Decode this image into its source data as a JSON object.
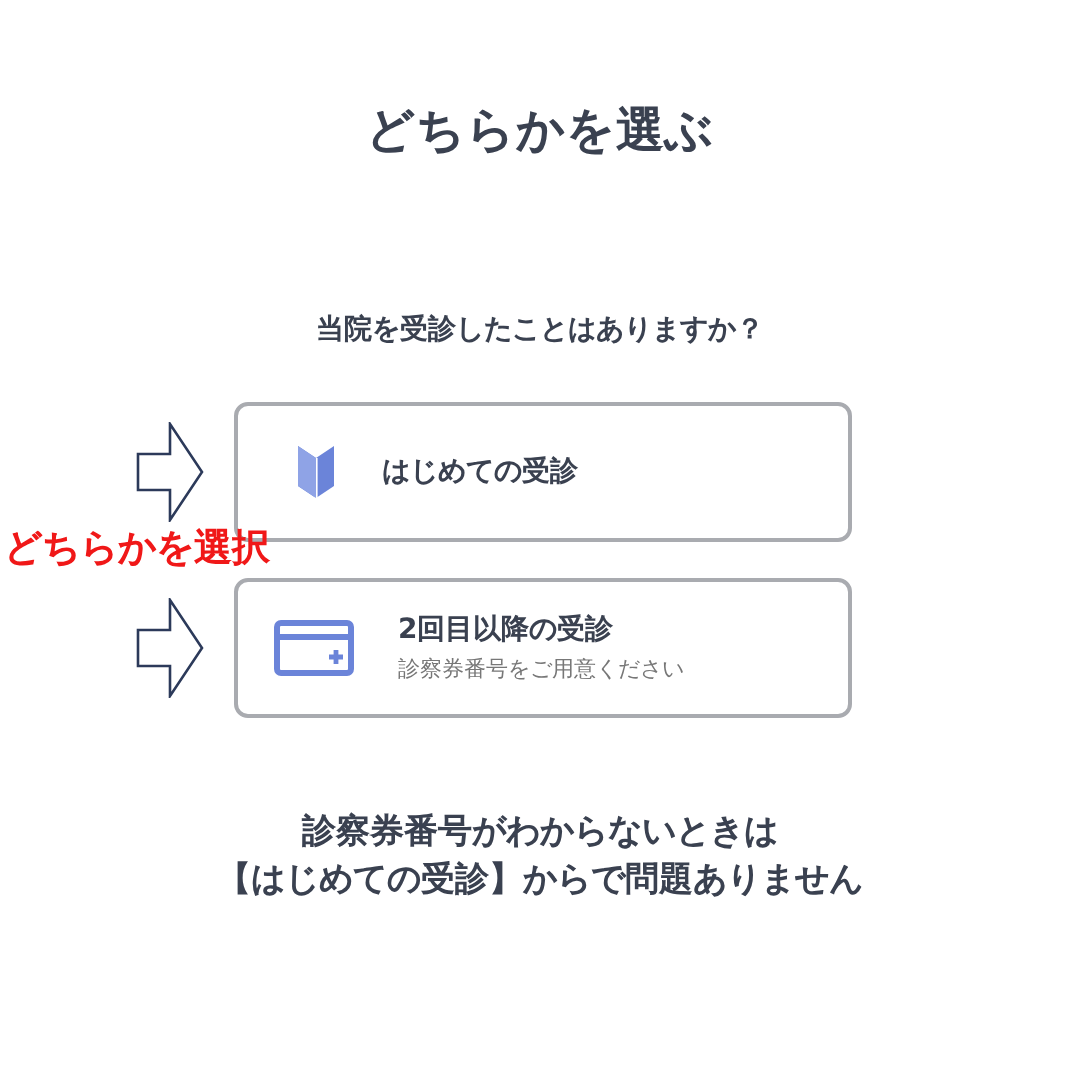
{
  "title": "どちらかを選ぶ",
  "question": "当院を受診したことはありますか？",
  "options": [
    {
      "kind": "first",
      "label": "はじめての受診"
    },
    {
      "kind": "return",
      "label": "2回目以降の受診",
      "sublabel": "診察券番号をご用意ください"
    }
  ],
  "annotation": "どちらかを選択",
  "note": [
    "診察券番号がわからないときは",
    "【はじめての受診】からで問題ありません"
  ]
}
